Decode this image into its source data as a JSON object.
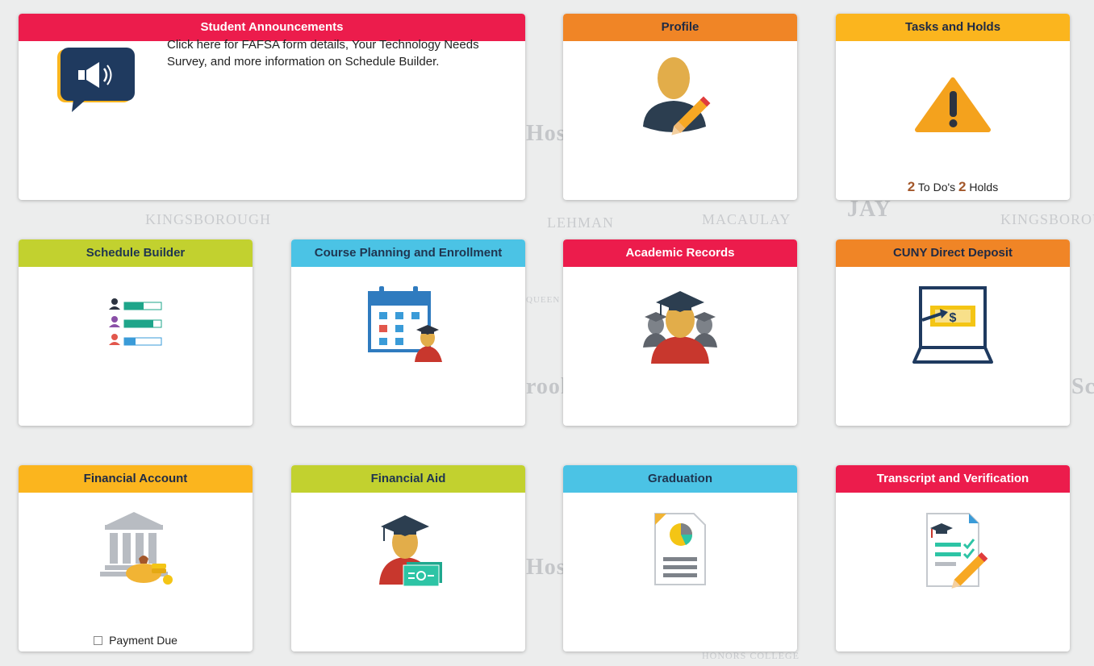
{
  "tiles": {
    "announcements": {
      "title": "Student Announcements",
      "text": "Click here for FAFSA form details, Your Technology Needs Survey, and more information on Schedule Builder."
    },
    "profile": {
      "title": "Profile"
    },
    "tasks": {
      "title": "Tasks and Holds",
      "todo_count": "2",
      "todo_label": "To Do's",
      "holds_count": "2",
      "holds_label": "Holds"
    },
    "schedule_builder": {
      "title": "Schedule Builder"
    },
    "course_planning": {
      "title": "Course Planning and Enrollment"
    },
    "academic_records": {
      "title": "Academic Records"
    },
    "direct_deposit": {
      "title": "CUNY Direct Deposit"
    },
    "financial_account": {
      "title": "Financial Account",
      "footer": "Payment Due"
    },
    "financial_aid": {
      "title": "Financial Aid"
    },
    "graduation": {
      "title": "Graduation"
    },
    "transcript": {
      "title": "Transcript and Verification"
    }
  },
  "background_logos": [
    "KINGSBOROUGH",
    "LEHMAN",
    "MACAULAY",
    "HONORS COLLEGE",
    "KINGSBOROU",
    "Hos",
    "rookl",
    "QUEEN",
    "JAY",
    "Sc"
  ],
  "colors": {
    "red": "#ec1c4c",
    "orange": "#f08526",
    "yellow": "#fbb51e",
    "green": "#c2d12f",
    "blue": "#4bc3e5",
    "navy": "#1f3a5f"
  }
}
